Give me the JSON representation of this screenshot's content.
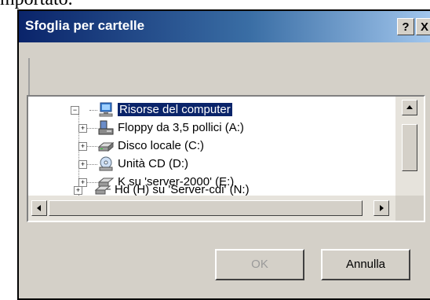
{
  "document": {
    "fragment": "mportato."
  },
  "dialog": {
    "title": "Sfoglia per cartelle",
    "help_button": "?",
    "close_button": "X",
    "tree": {
      "items": [
        {
          "label": "Risorse del computer",
          "icon": "computer-icon",
          "selected": true,
          "expander": "−"
        },
        {
          "label": "Floppy da 3,5 pollici (A:)",
          "icon": "floppy-icon",
          "expander": "+"
        },
        {
          "label": "Disco locale (C:)",
          "icon": "disk-icon",
          "expander": "+"
        },
        {
          "label": "Unità CD (D:)",
          "icon": "cd-icon",
          "expander": "+"
        },
        {
          "label": "K su 'server-2000' (E:)",
          "icon": "network-drive-icon",
          "expander": "+"
        },
        {
          "label": "Hd (H) su 'Server-cdi' (N:)",
          "icon": "network-drive-icon",
          "expander": "+"
        }
      ]
    },
    "ok_label": "OK",
    "cancel_label": "Annulla"
  },
  "colors": {
    "title_start": "#0a246a",
    "title_end": "#a6caf0",
    "face": "#d4d0c8",
    "selection": "#0a246a"
  }
}
